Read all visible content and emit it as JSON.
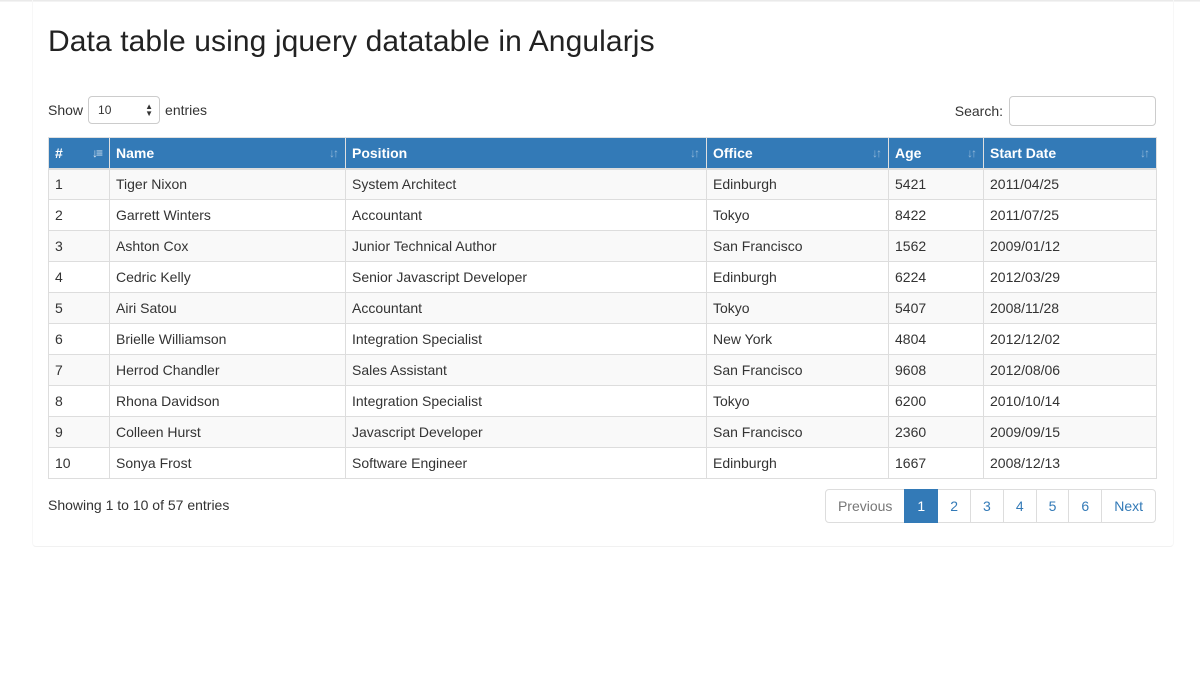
{
  "page": {
    "title": "Data table using jquery datatable in Angularjs"
  },
  "length": {
    "prefix": "Show",
    "value": "10",
    "suffix": "entries"
  },
  "search": {
    "label": "Search:",
    "value": ""
  },
  "table": {
    "columns": [
      {
        "label": "#",
        "sort": "asc"
      },
      {
        "label": "Name",
        "sort": "both"
      },
      {
        "label": "Position",
        "sort": "both"
      },
      {
        "label": "Office",
        "sort": "both"
      },
      {
        "label": "Age",
        "sort": "both"
      },
      {
        "label": "Start Date",
        "sort": "both"
      }
    ],
    "rows": [
      [
        "1",
        "Tiger Nixon",
        "System Architect",
        "Edinburgh",
        "5421",
        "2011/04/25"
      ],
      [
        "2",
        "Garrett Winters",
        "Accountant",
        "Tokyo",
        "8422",
        "2011/07/25"
      ],
      [
        "3",
        "Ashton Cox",
        "Junior Technical Author",
        "San Francisco",
        "1562",
        "2009/01/12"
      ],
      [
        "4",
        "Cedric Kelly",
        "Senior Javascript Developer",
        "Edinburgh",
        "6224",
        "2012/03/29"
      ],
      [
        "5",
        "Airi Satou",
        "Accountant",
        "Tokyo",
        "5407",
        "2008/11/28"
      ],
      [
        "6",
        "Brielle Williamson",
        "Integration Specialist",
        "New York",
        "4804",
        "2012/12/02"
      ],
      [
        "7",
        "Herrod Chandler",
        "Sales Assistant",
        "San Francisco",
        "9608",
        "2012/08/06"
      ],
      [
        "8",
        "Rhona Davidson",
        "Integration Specialist",
        "Tokyo",
        "6200",
        "2010/10/14"
      ],
      [
        "9",
        "Colleen Hurst",
        "Javascript Developer",
        "San Francisco",
        "2360",
        "2009/09/15"
      ],
      [
        "10",
        "Sonya Frost",
        "Software Engineer",
        "Edinburgh",
        "1667",
        "2008/12/13"
      ]
    ]
  },
  "info": "Showing 1 to 10 of 57 entries",
  "pagination": {
    "previous": "Previous",
    "next": "Next",
    "pages": [
      "1",
      "2",
      "3",
      "4",
      "5",
      "6"
    ],
    "current": "1"
  },
  "colors": {
    "accent": "#337ab7",
    "stripe": "#f9f9f9",
    "border": "#dddddd"
  }
}
